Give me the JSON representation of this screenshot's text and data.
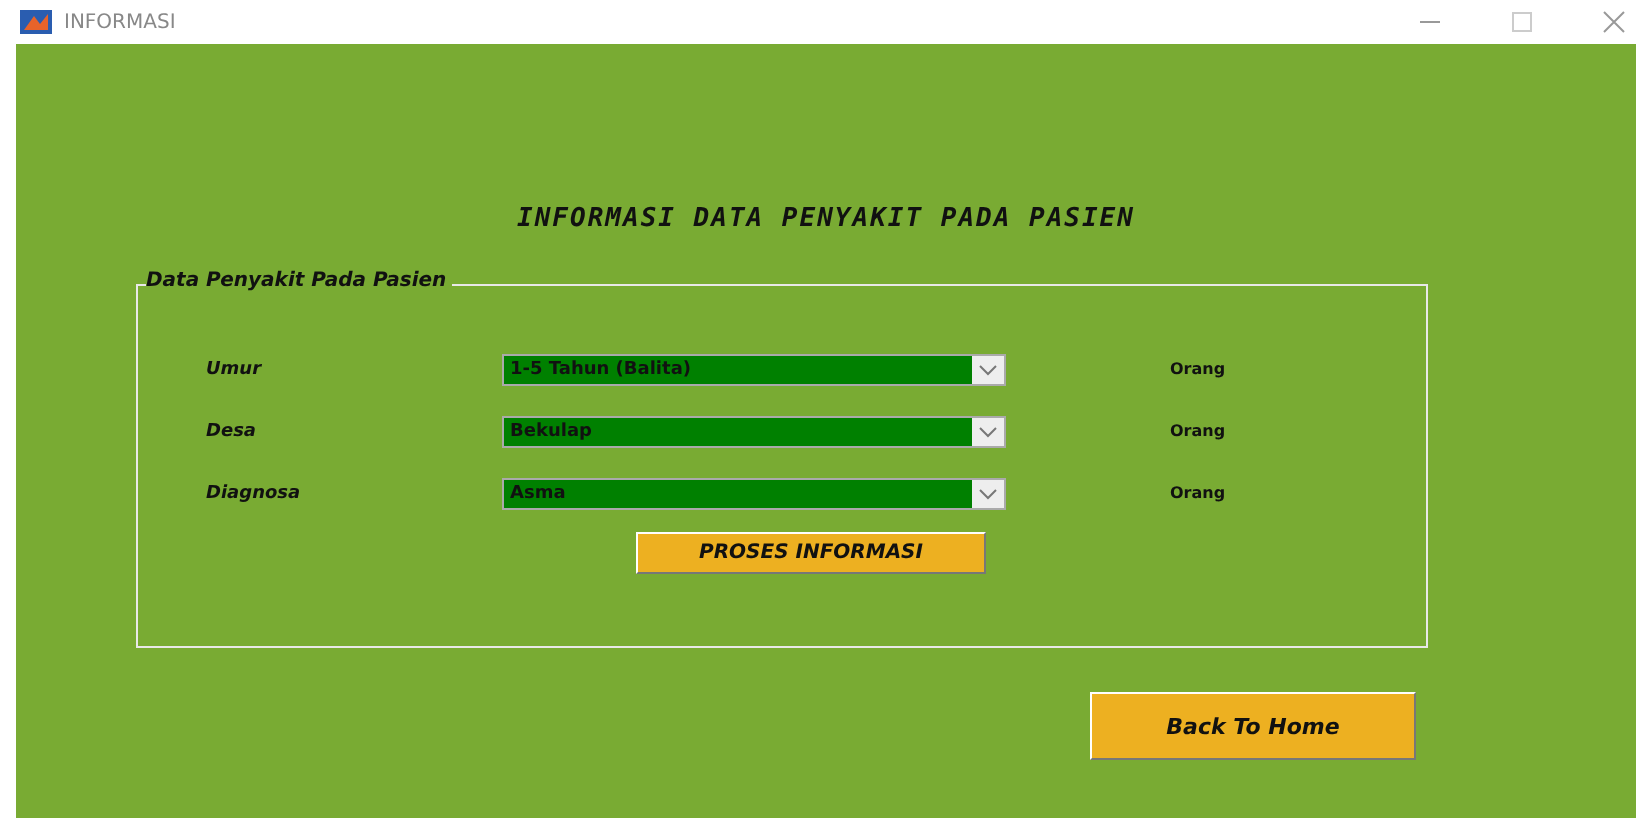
{
  "window": {
    "title": "INFORMASI"
  },
  "heading": "INFORMASI DATA PENYAKIT PADA PASIEN",
  "group": {
    "title": "Data Penyakit Pada Pasien",
    "rows": [
      {
        "label": "Umur",
        "value": "1-5 Tahun (Balita)",
        "unit": "Orang"
      },
      {
        "label": "Desa",
        "value": "Bekulap",
        "unit": "Orang"
      },
      {
        "label": "Diagnosa",
        "value": "Asma",
        "unit": "Orang"
      }
    ],
    "button": "PROSES INFORMASI"
  },
  "back_button": "Back To Home"
}
